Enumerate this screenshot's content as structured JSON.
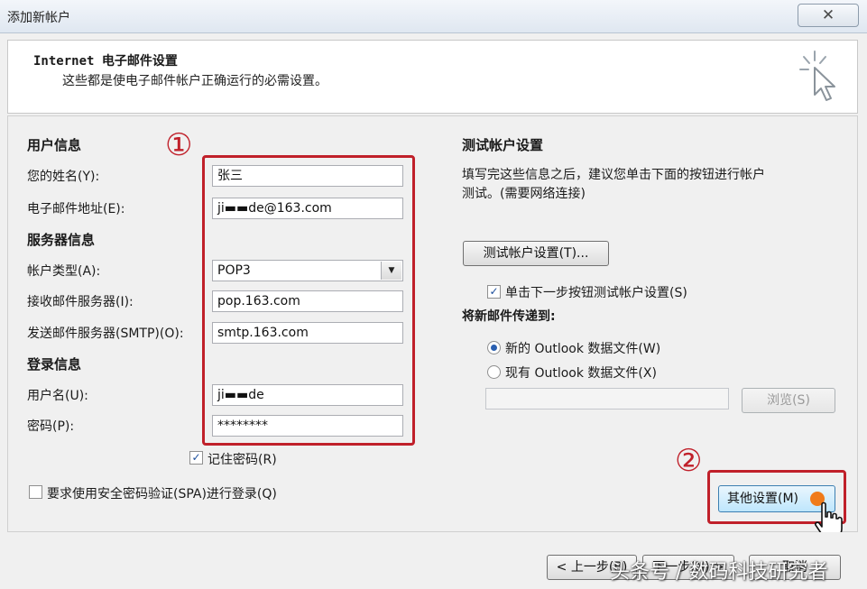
{
  "window": {
    "title": "添加新帐户",
    "close_glyph": "✕"
  },
  "header": {
    "title": "Internet 电子邮件设置",
    "subtitle": "这些都是使电子邮件帐户正确运行的必需设置。"
  },
  "user_info": {
    "section": "用户信息",
    "name_label": "您的姓名(Y):",
    "name_value": "张三",
    "email_label": "电子邮件地址(E):",
    "email_value": "ji▬▬de@163.com"
  },
  "server_info": {
    "section": "服务器信息",
    "account_type_label": "帐户类型(A):",
    "account_type_value": "POP3",
    "incoming_label": "接收邮件服务器(I):",
    "incoming_value": "pop.163.com",
    "outgoing_label": "发送邮件服务器(SMTP)(O):",
    "outgoing_value": "smtp.163.com"
  },
  "login_info": {
    "section": "登录信息",
    "username_label": "用户名(U):",
    "username_value": "ji▬▬de",
    "password_label": "密码(P):",
    "password_value": "********",
    "remember_label": "记住密码(R)",
    "remember_checked": true,
    "spa_label": "要求使用安全密码验证(SPA)进行登录(Q)",
    "spa_checked": false
  },
  "test_settings": {
    "section": "测试帐户设置",
    "description_line1": "填写完这些信息之后，建议您单击下面的按钮进行帐户",
    "description_line2": "测试。(需要网络连接)",
    "test_button": "测试帐户设置(T)...",
    "auto_test_label": "单击下一步按钮测试帐户设置(S)",
    "auto_test_checked": true
  },
  "deliver": {
    "section": "将新邮件传递到:",
    "option_new": "新的 Outlook 数据文件(W)",
    "option_existing": "现有 Outlook 数据文件(X)",
    "selected": "new",
    "browse_button": "浏览(S)"
  },
  "more_settings_button": "其他设置(M)",
  "annotations": {
    "marker1": "①",
    "marker2": "②"
  },
  "footer": {
    "back_button": "< 上一步(B)",
    "next_button": "下一步(N) >",
    "cancel_button": "取消"
  },
  "watermark": "头条号 / 数码科技研究者",
  "colors": {
    "annotation_red": "#c0202a",
    "orange_dot": "#f07b1a",
    "accent_blue": "#2a5fb0"
  }
}
